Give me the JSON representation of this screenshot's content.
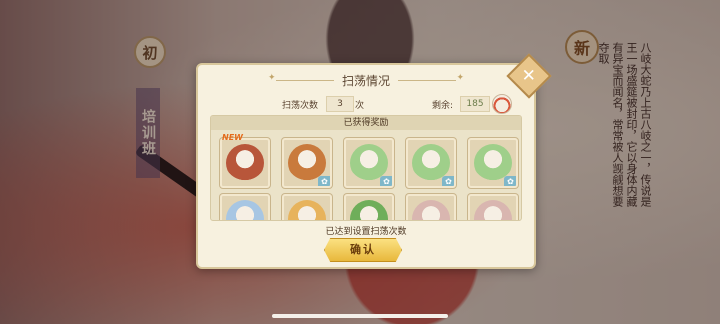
{
  "background": {
    "left_badge": "初",
    "left_column_text": "培训班",
    "right_badge": "新",
    "right_lore_text": "八岐大蛇乃上古八岐之一，传说是王一场盛筵被封印，它以身体内藏有异宝而闻名，常常被人觊觎想要夺取"
  },
  "dialog": {
    "title": "扫荡情况",
    "sweep_count_label": "扫荡次数",
    "sweep_count_value": "3",
    "sweep_count_unit": "次",
    "remaining_label": "剩余:",
    "remaining_value": "185",
    "rewards_title": "已获得奖励",
    "status_message": "已达到设置扫荡次数",
    "confirm_label": "确认",
    "new_tag": "NEW",
    "items": [
      {
        "name": "reward-shikigami-new",
        "color": "#b8563a"
      },
      {
        "name": "reward-food-bowl-1",
        "color": "#c97a3c",
        "tag": "✿"
      },
      {
        "name": "reward-chibi-bowl-1",
        "color": "#9fcf8a",
        "tag": "✿"
      },
      {
        "name": "reward-chibi-bowl-2",
        "color": "#9fcf8a",
        "tag": "✿"
      },
      {
        "name": "reward-chibi-bowl-3",
        "color": "#9fcf8a",
        "tag": "✿"
      },
      {
        "name": "reward-dumpling",
        "color": "#a7c6e3"
      },
      {
        "name": "reward-bun",
        "color": "#e7b35c"
      },
      {
        "name": "reward-green-spirit",
        "color": "#6fae5a"
      },
      {
        "name": "reward-chibi-white-1",
        "color": "#d9b6b0"
      },
      {
        "name": "reward-chibi-white-2",
        "color": "#d9b6b0"
      }
    ]
  },
  "colors": {
    "panel": "#f7f1df",
    "button": "#e8b83c",
    "accent": "#d9573c"
  }
}
